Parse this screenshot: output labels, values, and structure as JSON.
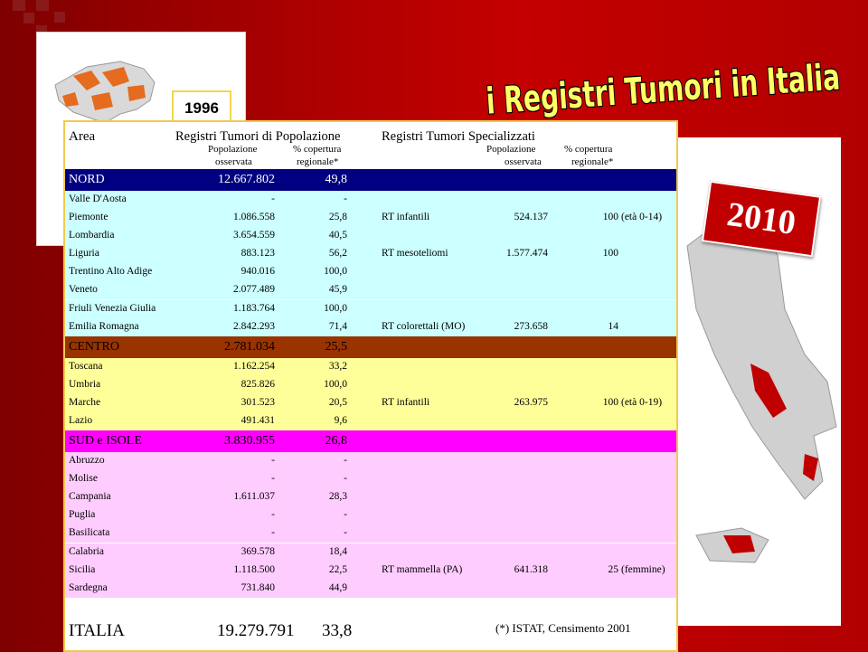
{
  "title": "i Registri Tumori in Italia",
  "year_1996": "1996",
  "year_2010": "2010",
  "header": {
    "area": "Area",
    "pop_group": "Registri Tumori di Popolazione",
    "spec_group": "Registri Tumori Specializzati",
    "pop_col": "Popolazione",
    "pop_col2": "osservata",
    "cov_col": "% copertura",
    "cov_col2": "regionale*",
    "spop_col": "Popolazione",
    "spop_col2": "osservata",
    "scov_col": "% copertura",
    "scov_col2": "regionale*"
  },
  "rows": [
    {
      "area": "NORD",
      "pop": "12.667.802",
      "cov": "49,8",
      "rt": "",
      "rtpop": "",
      "rtcov": "",
      "note": ""
    },
    {
      "area": "Valle D'Aosta",
      "pop": "-",
      "cov": "-",
      "rt": "",
      "rtpop": "",
      "rtcov": "",
      "note": ""
    },
    {
      "area": "Piemonte",
      "pop": "1.086.558",
      "cov": "25,8",
      "rt": "RT infantili",
      "rtpop": "524.137",
      "rtcov": "100",
      "note": "(età 0-14)"
    },
    {
      "area": "Lombardia",
      "pop": "3.654.559",
      "cov": "40,5",
      "rt": "",
      "rtpop": "",
      "rtcov": "",
      "note": ""
    },
    {
      "area": "Liguria",
      "pop": "883.123",
      "cov": "56,2",
      "rt": "RT mesoteliomi",
      "rtpop": "1.577.474",
      "rtcov": "100",
      "note": ""
    },
    {
      "area": "Trentino Alto Adige",
      "pop": "940.016",
      "cov": "100,0",
      "rt": "",
      "rtpop": "",
      "rtcov": "",
      "note": ""
    },
    {
      "area": "Veneto",
      "pop": "2.077.489",
      "cov": "45,9",
      "rt": "",
      "rtpop": "",
      "rtcov": "",
      "note": ""
    },
    {
      "area": "Friuli Venezia Giulia",
      "pop": "1.183.764",
      "cov": "100,0",
      "rt": "",
      "rtpop": "",
      "rtcov": "",
      "note": ""
    },
    {
      "area": "Emilia Romagna",
      "pop": "2.842.293",
      "cov": "71,4",
      "rt": "RT colorettali (MO)",
      "rtpop": "273.658",
      "rtcov": "14",
      "note": ""
    },
    {
      "area": "CENTRO",
      "pop": "2.781.034",
      "cov": "25,5",
      "rt": "",
      "rtpop": "",
      "rtcov": "",
      "note": ""
    },
    {
      "area": "Toscana",
      "pop": "1.162.254",
      "cov": "33,2",
      "rt": "",
      "rtpop": "",
      "rtcov": "",
      "note": ""
    },
    {
      "area": "Umbria",
      "pop": "825.826",
      "cov": "100,0",
      "rt": "",
      "rtpop": "",
      "rtcov": "",
      "note": ""
    },
    {
      "area": "Marche",
      "pop": "301.523",
      "cov": "20,5",
      "rt": "RT infantili",
      "rtpop": "263.975",
      "rtcov": "100",
      "note": "(età 0-19)"
    },
    {
      "area": "Lazio",
      "pop": "491.431",
      "cov": "9,6",
      "rt": "",
      "rtpop": "",
      "rtcov": "",
      "note": ""
    },
    {
      "area": "SUD e ISOLE",
      "pop": "3.830.955",
      "cov": "26,8",
      "rt": "",
      "rtpop": "",
      "rtcov": "",
      "note": ""
    },
    {
      "area": "Abruzzo",
      "pop": "-",
      "cov": "-",
      "rt": "",
      "rtpop": "",
      "rtcov": "",
      "note": ""
    },
    {
      "area": "Molise",
      "pop": "-",
      "cov": "-",
      "rt": "",
      "rtpop": "",
      "rtcov": "",
      "note": ""
    },
    {
      "area": "Campania",
      "pop": "1.611.037",
      "cov": "28,3",
      "rt": "",
      "rtpop": "",
      "rtcov": "",
      "note": ""
    },
    {
      "area": "Puglia",
      "pop": "-",
      "cov": "-",
      "rt": "",
      "rtpop": "",
      "rtcov": "",
      "note": ""
    },
    {
      "area": "Basilicata",
      "pop": "-",
      "cov": "-",
      "rt": "",
      "rtpop": "",
      "rtcov": "",
      "note": ""
    },
    {
      "area": "Calabria",
      "pop": "369.578",
      "cov": "18,4",
      "rt": "",
      "rtpop": "",
      "rtcov": "",
      "note": ""
    },
    {
      "area": "Sicilia",
      "pop": "1.118.500",
      "cov": "22,5",
      "rt": "RT mammella (PA)",
      "rtpop": "641.318",
      "rtcov": "25",
      "note": "(femmine)"
    },
    {
      "area": "Sardegna",
      "pop": "731.840",
      "cov": "44,9",
      "rt": "",
      "rtpop": "",
      "rtcov": "",
      "note": ""
    }
  ],
  "total": {
    "area": "ITALIA",
    "pop": "19.279.791",
    "cov": "33,8"
  },
  "footnote": "(*) ISTAT, Censimento 2001",
  "colors": {
    "nord_header": "#000080",
    "nord_rows": "#ccffff",
    "centro_header": "#993300",
    "centro_rows": "#ffff99",
    "sud_header": "#ff00ff",
    "sud_rows": "#ffccff",
    "title_fill": "#ffff66",
    "title_stroke": "#000000",
    "frame_border": "#f2c94c"
  }
}
